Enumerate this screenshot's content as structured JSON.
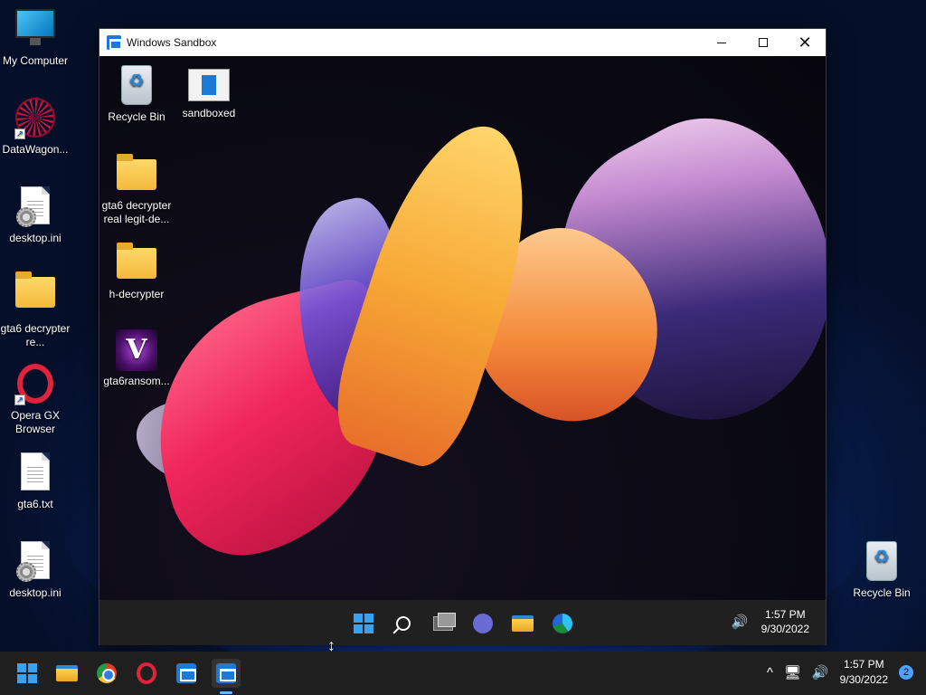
{
  "host_desktop": {
    "icons": [
      {
        "label": "My Computer",
        "icon": "monitor-icon"
      },
      {
        "label": "DataWagon...",
        "icon": "datawagon-icon",
        "shortcut": true
      },
      {
        "label": "desktop.ini",
        "icon": "settings-file-icon"
      },
      {
        "label": "gta6 decrypter re...",
        "icon": "folder-icon"
      },
      {
        "label": "Opera GX Browser",
        "icon": "opera-gx-icon",
        "shortcut": true
      },
      {
        "label": "gta6.txt",
        "icon": "text-file-icon"
      },
      {
        "label": "desktop.ini",
        "icon": "settings-file-icon"
      },
      {
        "label": "Recycle Bin",
        "icon": "recycle-bin-icon"
      }
    ]
  },
  "window": {
    "title": "Windows Sandbox",
    "controls": {
      "minimize": "minimize",
      "maximize": "maximize",
      "close": "close"
    }
  },
  "guest_desktop": {
    "icons": [
      {
        "label": "Recycle Bin",
        "icon": "recycle-bin-icon"
      },
      {
        "label": "sandboxed",
        "icon": "sandboxed-file-icon"
      },
      {
        "label": "gta6 decrypter real legit-de...",
        "icon": "folder-icon"
      },
      {
        "label": "h-decrypter",
        "icon": "folder-icon"
      },
      {
        "label": "gta6ransom...",
        "icon": "v-app-icon"
      }
    ],
    "taskbar": {
      "apps": [
        "start-icon",
        "search-icon",
        "task-view-icon",
        "chat-icon",
        "file-explorer-icon",
        "edge-icon"
      ],
      "time": "1:57 PM",
      "date": "9/30/2022"
    }
  },
  "host_taskbar": {
    "apps": [
      "start-icon",
      "file-explorer-icon",
      "chrome-icon",
      "opera-gx-icon",
      "sandbox-icon",
      "sandbox-icon"
    ],
    "time": "1:57 PM",
    "date": "9/30/2022",
    "notification_count": "2"
  },
  "colors": {
    "accent": "#1c79d6",
    "taskbar": "#1f1f1f",
    "title_bar": "#ffffff"
  }
}
